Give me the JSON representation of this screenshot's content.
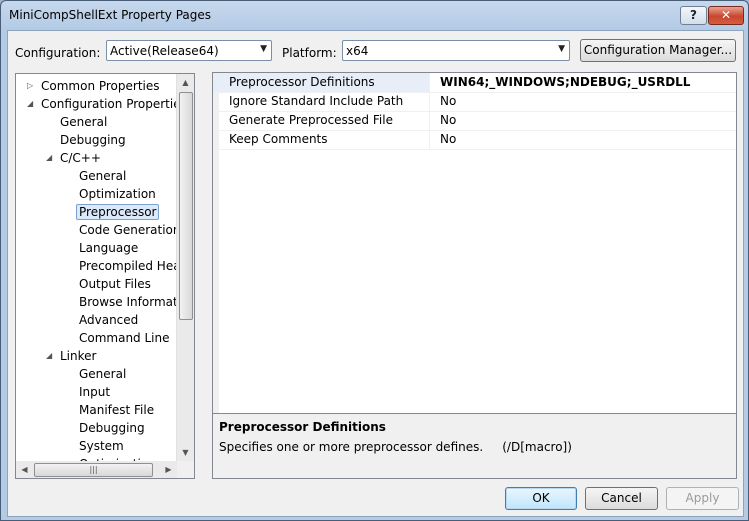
{
  "window": {
    "title": "MiniCompShellExt Property Pages"
  },
  "toolbar": {
    "configuration_label": "Configuration:",
    "configuration_value": "Active(Release64)",
    "platform_label": "Platform:",
    "platform_value": "x64",
    "config_manager_label": "Configuration Manager..."
  },
  "tree": {
    "items": [
      {
        "label": "Common Properties",
        "expander": "▷"
      },
      {
        "label": "Configuration Properties",
        "expander": "◢"
      },
      {
        "label": "General"
      },
      {
        "label": "Debugging"
      },
      {
        "label": "C/C++",
        "expander": "◢"
      },
      {
        "label": "General"
      },
      {
        "label": "Optimization"
      },
      {
        "label": "Preprocessor",
        "selected": true
      },
      {
        "label": "Code Generation"
      },
      {
        "label": "Language"
      },
      {
        "label": "Precompiled Heade"
      },
      {
        "label": "Output Files"
      },
      {
        "label": "Browse Information"
      },
      {
        "label": "Advanced"
      },
      {
        "label": "Command Line"
      },
      {
        "label": "Linker",
        "expander": "◢"
      },
      {
        "label": "General"
      },
      {
        "label": "Input"
      },
      {
        "label": "Manifest File"
      },
      {
        "label": "Debugging"
      },
      {
        "label": "System"
      },
      {
        "label": "Optimization"
      }
    ]
  },
  "grid": {
    "rows": [
      {
        "name": "Preprocessor Definitions",
        "value": "WIN64;_WINDOWS;NDEBUG;_USRDLL",
        "selected": true
      },
      {
        "name": "Ignore Standard Include Path",
        "value": "No"
      },
      {
        "name": "Generate Preprocessed File",
        "value": "No"
      },
      {
        "name": "Keep Comments",
        "value": "No"
      }
    ]
  },
  "description": {
    "title": "Preprocessor Definitions",
    "text": "Specifies one or more preprocessor defines.     (/D[macro])"
  },
  "buttons": {
    "ok_label": "OK",
    "cancel_label": "Cancel",
    "apply_label": "Apply"
  },
  "icons": {
    "help": "?",
    "close": "✕",
    "dropdown": "▼"
  }
}
